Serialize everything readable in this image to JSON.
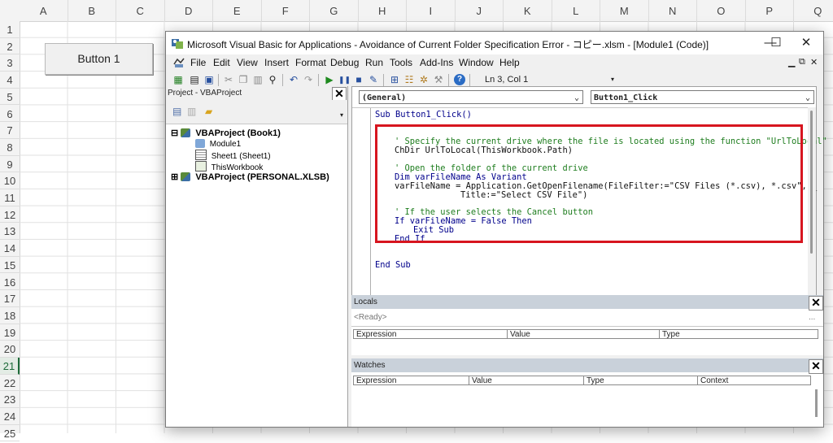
{
  "excel": {
    "columns": [
      "A",
      "B",
      "C",
      "D",
      "E",
      "F",
      "G",
      "H",
      "I",
      "J",
      "K",
      "L",
      "M",
      "N",
      "O",
      "P",
      "Q"
    ],
    "rows": [
      "1",
      "2",
      "3",
      "4",
      "5",
      "6",
      "7",
      "8",
      "9",
      "10",
      "11",
      "12",
      "13",
      "14",
      "15",
      "16",
      "17",
      "18",
      "19",
      "20",
      "21",
      "22",
      "23",
      "24",
      "25"
    ],
    "selected_row": "21",
    "button_label": "Button 1"
  },
  "window": {
    "title": "Microsoft Visual Basic for Applications - Avoidance of Current Folder Specification Error - コピー.xlsm - [Module1 (Code)]",
    "minimize": "—",
    "maximize": "☐",
    "close": "✕"
  },
  "menu": {
    "items": [
      {
        "label": "File"
      },
      {
        "label": "Edit"
      },
      {
        "label": "View"
      },
      {
        "label": "Insert"
      },
      {
        "label": "Format"
      },
      {
        "label": "Debug"
      },
      {
        "label": "Run"
      },
      {
        "label": "Tools"
      },
      {
        "label": "Add-Ins"
      },
      {
        "label": "Window"
      },
      {
        "label": "Help"
      }
    ]
  },
  "toolbar": {
    "cursor_position": "Ln 3, Col 1",
    "icons": [
      "excel-icon",
      "insert-module-icon",
      "save-icon",
      "cut-icon",
      "copy-icon",
      "paste-icon",
      "find-icon",
      "undo-icon",
      "redo-icon",
      "run-icon",
      "break-icon",
      "reset-icon",
      "design-mode-icon",
      "project-explorer-icon",
      "properties-icon",
      "object-browser-icon",
      "toolbox-icon",
      "help-icon"
    ]
  },
  "project": {
    "title": "Project - VBAProject",
    "tree": [
      {
        "label": "VBAProject (Book1)",
        "level": 0,
        "expander": "⊟"
      },
      {
        "label": "Module1",
        "level": 1
      },
      {
        "label": "Sheet1 (Sheet1)",
        "level": 1
      },
      {
        "label": "ThisWorkbook",
        "level": 1
      },
      {
        "label": "VBAProject (PERSONAL.XLSB)",
        "level": 0,
        "expander": "⊞"
      }
    ]
  },
  "code": {
    "object_combo": "(General)",
    "procedure_combo": "Button1_Click",
    "lines": [
      {
        "text": "Sub Button1_Click()",
        "kind": "kw",
        "indent": 0
      },
      {
        "text": "' Specify the current drive where the file is located using the function \"UrlToLocal\"",
        "kind": "cm",
        "indent": 1
      },
      {
        "text": "ChDir UrlToLocal(ThisWorkbook.Path)",
        "kind": "pl",
        "indent": 1
      },
      {
        "text": "' Open the folder of the current drive",
        "kind": "cm",
        "indent": 1
      },
      {
        "text": "Dim varFileName As Variant",
        "kind": "kw",
        "indent": 1
      },
      {
        "text": "varFileName = Application.GetOpenFilename(FileFilter:=\"CSV Files (*.csv), *.csv\", _",
        "kind": "pl",
        "indent": 1
      },
      {
        "text": "Title:=\"Select CSV File\")",
        "kind": "pl",
        "indent": 3
      },
      {
        "text": "' If the user selects the Cancel button",
        "kind": "cm",
        "indent": 1
      },
      {
        "text": "If varFileName = False Then",
        "kind": "kw",
        "indent": 1
      },
      {
        "text": "Exit Sub",
        "kind": "kw",
        "indent": 2
      },
      {
        "text": "End If",
        "kind": "kw",
        "indent": 1
      },
      {
        "text": "End Sub",
        "kind": "kw",
        "indent": 0
      }
    ],
    "highlight_color": "#d7151f"
  },
  "locals": {
    "title": "Locals",
    "status": "<Ready>",
    "ellipsis": "...",
    "columns": [
      "Expression",
      "Value",
      "Type"
    ]
  },
  "watches": {
    "title": "Watches",
    "columns": [
      "Expression",
      "Value",
      "Type",
      "Context"
    ]
  }
}
